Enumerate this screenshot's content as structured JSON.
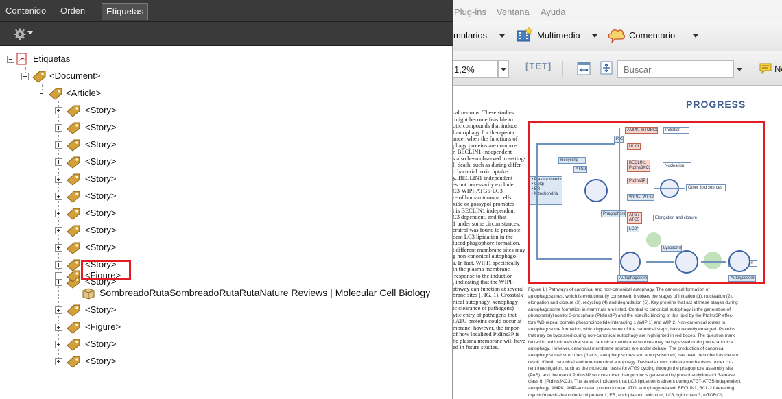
{
  "panel": {
    "tabs": [
      "Contenido",
      "Orden",
      "Etiquetas"
    ],
    "active_tab": "Etiquetas",
    "options_icon": "gear-icon"
  },
  "tree": {
    "root": "Etiquetas",
    "document": "<Document>",
    "article": "<Article>",
    "stories_before": [
      "<Story>",
      "<Story>",
      "<Story>",
      "<Story>",
      "<Story>",
      "<Story>",
      "<Story>",
      "<Story>",
      "<Story>",
      "<Story>",
      "<Story>"
    ],
    "selected_figure": "<Figure>",
    "figure_child": "SombreadoRutaSombreadoRutaRutaNature Reviews | Molecular Cell Biology",
    "after": [
      "<Story>",
      "<Figure>",
      "<Story>",
      "<Story>"
    ]
  },
  "menubar": {
    "items": [
      "Plug-ins",
      "Ventana",
      "Ayuda"
    ]
  },
  "toolbar1": {
    "forms_label": "mularios",
    "multimedia_label": "Multimedia",
    "comment_label": "Comentario"
  },
  "toolbar2": {
    "zoom_value": "1,2%",
    "tet_label": "[TET]",
    "search_placeholder": "Buscar",
    "note_label": "No"
  },
  "document": {
    "section_title": "PROGRESS",
    "figure_labels": {
      "initiation": "Initiation",
      "ampk": "AMPK, mTORC1",
      "ulk1": "ULK1",
      "pas": "PAS",
      "recycling": "Recycling",
      "atg9": "ATG9",
      "sources": "• Plasma membrane\n• Golgi\n• ER\n• Mitochondria",
      "beclin": "BECLIN1\nPtdIns3KC3",
      "nucleation": "Nucleation",
      "ptdins3p": "PtdIns3P",
      "other_lipid": "Other lipid sources",
      "wipi": "WIPI1, WIPI2",
      "phagophore": "Phagophore",
      "atg7": "ATG7\nATG5",
      "lc3": "LC3*",
      "elongation": "Elongation and closure",
      "lysosome": "Lysosome",
      "degradation": "Degradation",
      "autophagosome": "Autophagosome",
      "autolysosome": "Autolysosome"
    }
  }
}
